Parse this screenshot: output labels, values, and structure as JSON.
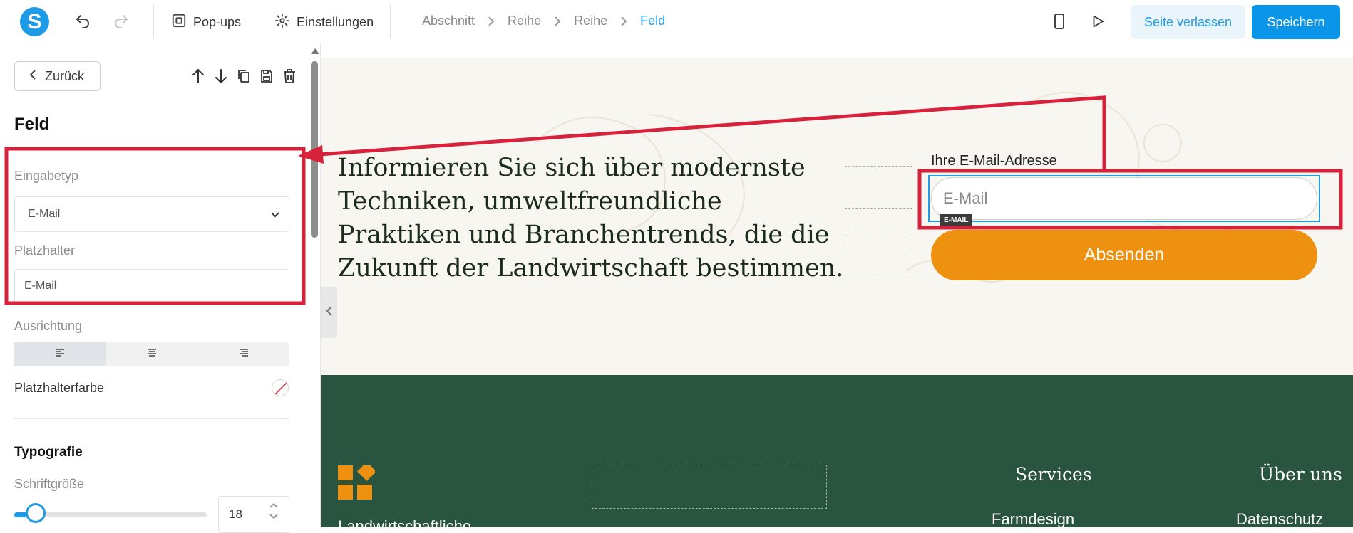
{
  "topbar": {
    "logo_letter": "S",
    "popups_label": "Pop-ups",
    "settings_label": "Einstellungen",
    "breadcrumbs": [
      "Abschnitt",
      "Reihe",
      "Reihe",
      "Feld"
    ],
    "leave_label": "Seite verlassen",
    "save_label": "Speichern"
  },
  "panel": {
    "back_label": "Zurück",
    "title": "Feld",
    "input_type_label": "Eingabetyp",
    "input_type_value": "E-Mail",
    "placeholder_label": "Platzhalter",
    "placeholder_value": "E-Mail",
    "alignment_label": "Ausrichtung",
    "alignment_selected": "left",
    "placeholder_color_label": "Platzhalterfarbe",
    "typography_title": "Typografie",
    "font_size_label": "Schriftgröße",
    "font_size_value": "18"
  },
  "canvas": {
    "hero_text": "Informieren Sie sich über modernste Techniken, umweltfreundliche Praktiken und Branchentrends, die die Zukunft der Landwirtschaft bestimmen.",
    "email_label": "Ihre E-Mail-Adresse",
    "email_placeholder": "E-Mail",
    "email_tag": "E-MAIL",
    "submit_label": "Absenden",
    "footer": {
      "heading_services": "Services",
      "heading_about": "Über uns",
      "link_services": "Farmdesign",
      "link_about": "Datenschutz",
      "partial_text": "Landwirtschaftliche"
    }
  },
  "colors": {
    "accent": "#1e9be6",
    "annotation_red": "#d8213a",
    "button_orange": "#ee9010",
    "footer_green": "#285440",
    "hero_bg": "#f8f6f0"
  }
}
